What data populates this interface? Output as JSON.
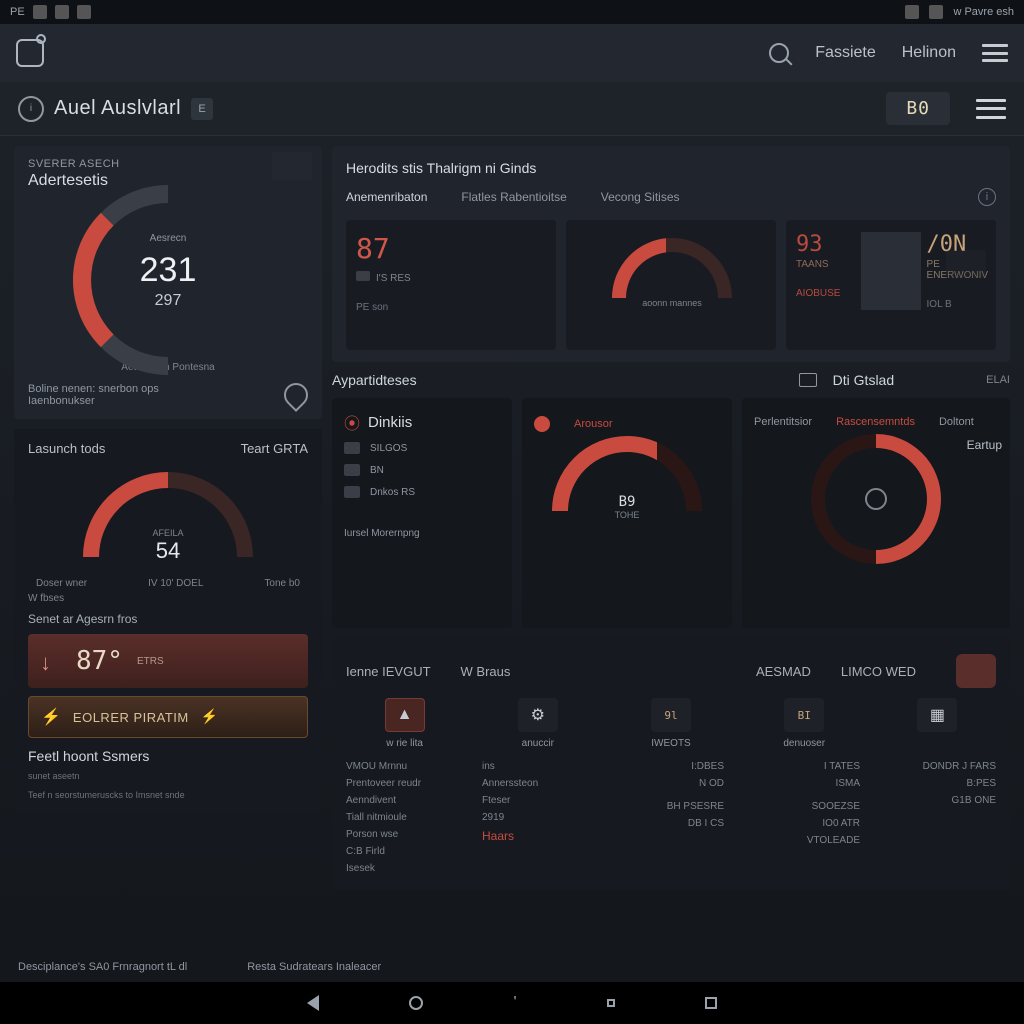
{
  "statusbar": {
    "left_label": "PE",
    "right_label": "w Pavre esh"
  },
  "header": {
    "nav1": "Fassiete",
    "nav2": "Helinon"
  },
  "subheader": {
    "title": "Auel Auslvlarl",
    "badge": "B0"
  },
  "left": {
    "p1_sub": "Sverer Asech",
    "p1_title": "Adertesetis",
    "gauge_label": "Aesrecn",
    "gauge_value": "231",
    "gauge_sub": "297",
    "gauge_bottom": "Aetesraom Pontesna",
    "p1_foot1": "Boline nenen: snerbon ops",
    "p1_foot2": "Iaenbonukser",
    "p2_left": "Lasunch tods",
    "p2_right": "Teart GRTA",
    "g2_left": "Doser wner",
    "g2_right": "Tone b0",
    "g2_val": "54",
    "g2_side": "W fbses",
    "send": "Senet ar Agesrn fros",
    "btn1_val": "87°",
    "btn1_unit": "ETRS",
    "btn2": "EOLRER PIRATIM",
    "sect": "Feetl hoont Ssmers",
    "tiny1": "sunet aseetn",
    "tiny2": "Teef n seorstumeruscks to Imsnet snde"
  },
  "rtop": {
    "title": "Herodits stis Thalrigm ni Ginds",
    "tab1": "Anemenribaton",
    "tab2": "Flatles Rabentioitse",
    "tab3": "Vecong Sitises",
    "m1_val": "87",
    "m1_sub": "I'S RES",
    "m1_foot": "PE son",
    "m2_lbl": "aoonn mannes",
    "m3_stat": "AIOBUSE",
    "m3_val": "93",
    "m3_unit": "TAANS",
    "m4_val": "/0N",
    "m4_sub": "PE ENERWONIV",
    "m4_foot": "IOL B"
  },
  "rmid": {
    "sec1": "Aypartidteses",
    "sec2": "Dti Gtslad",
    "sec3": "ELAI",
    "dink": "Dinkiis",
    "f_alert": "Arousor",
    "f2": "Perlentitsior",
    "f3": "Rascensemntds",
    "f4": "Doltont",
    "st1": "SILGOS",
    "st1b": "BN",
    "st2": "Dnkos RS",
    "st3": "Iursel Morernpng",
    "g3_val": "B9",
    "g3_unit": "TOHE",
    "ring_label": "Eartup"
  },
  "tiles": {
    "h1": "Ienne IEVGUT",
    "h2": "W Braus",
    "h3": "AESMAD",
    "h4": "LIMCO WED",
    "t1": "w rie lita",
    "t2": "anuccir",
    "t3": "IWEOTS",
    "t4": "denuoser",
    "tv1": "9l",
    "tv2": "BI"
  },
  "tbl": {
    "c1": [
      "VMOU Mrnnu",
      "Prentoveer reudr",
      "Aenndivent",
      "Tiall nitmioule",
      "Porson wse",
      "C:B Firld",
      "Isesek"
    ],
    "c2": [
      "ins",
      "Annerssteon",
      "Fteser",
      "2919",
      ""
    ],
    "hl": "Haars",
    "c3": [
      "I:DBES",
      "N OD",
      "",
      "BH  PSESRE",
      "DB  I CS"
    ],
    "c4": [
      "I TATES",
      "ISMA",
      "",
      "SOOEZSE",
      "IO0 ATR",
      "VTOLEADE"
    ],
    "c5": [
      "DONDR J FARS",
      "B:PES",
      "G1B  ONE"
    ]
  },
  "footer": {
    "l": "Desciplance's SA0 Frnragnort tL dl",
    "r": "Resta Sudratears Inaleacer"
  }
}
